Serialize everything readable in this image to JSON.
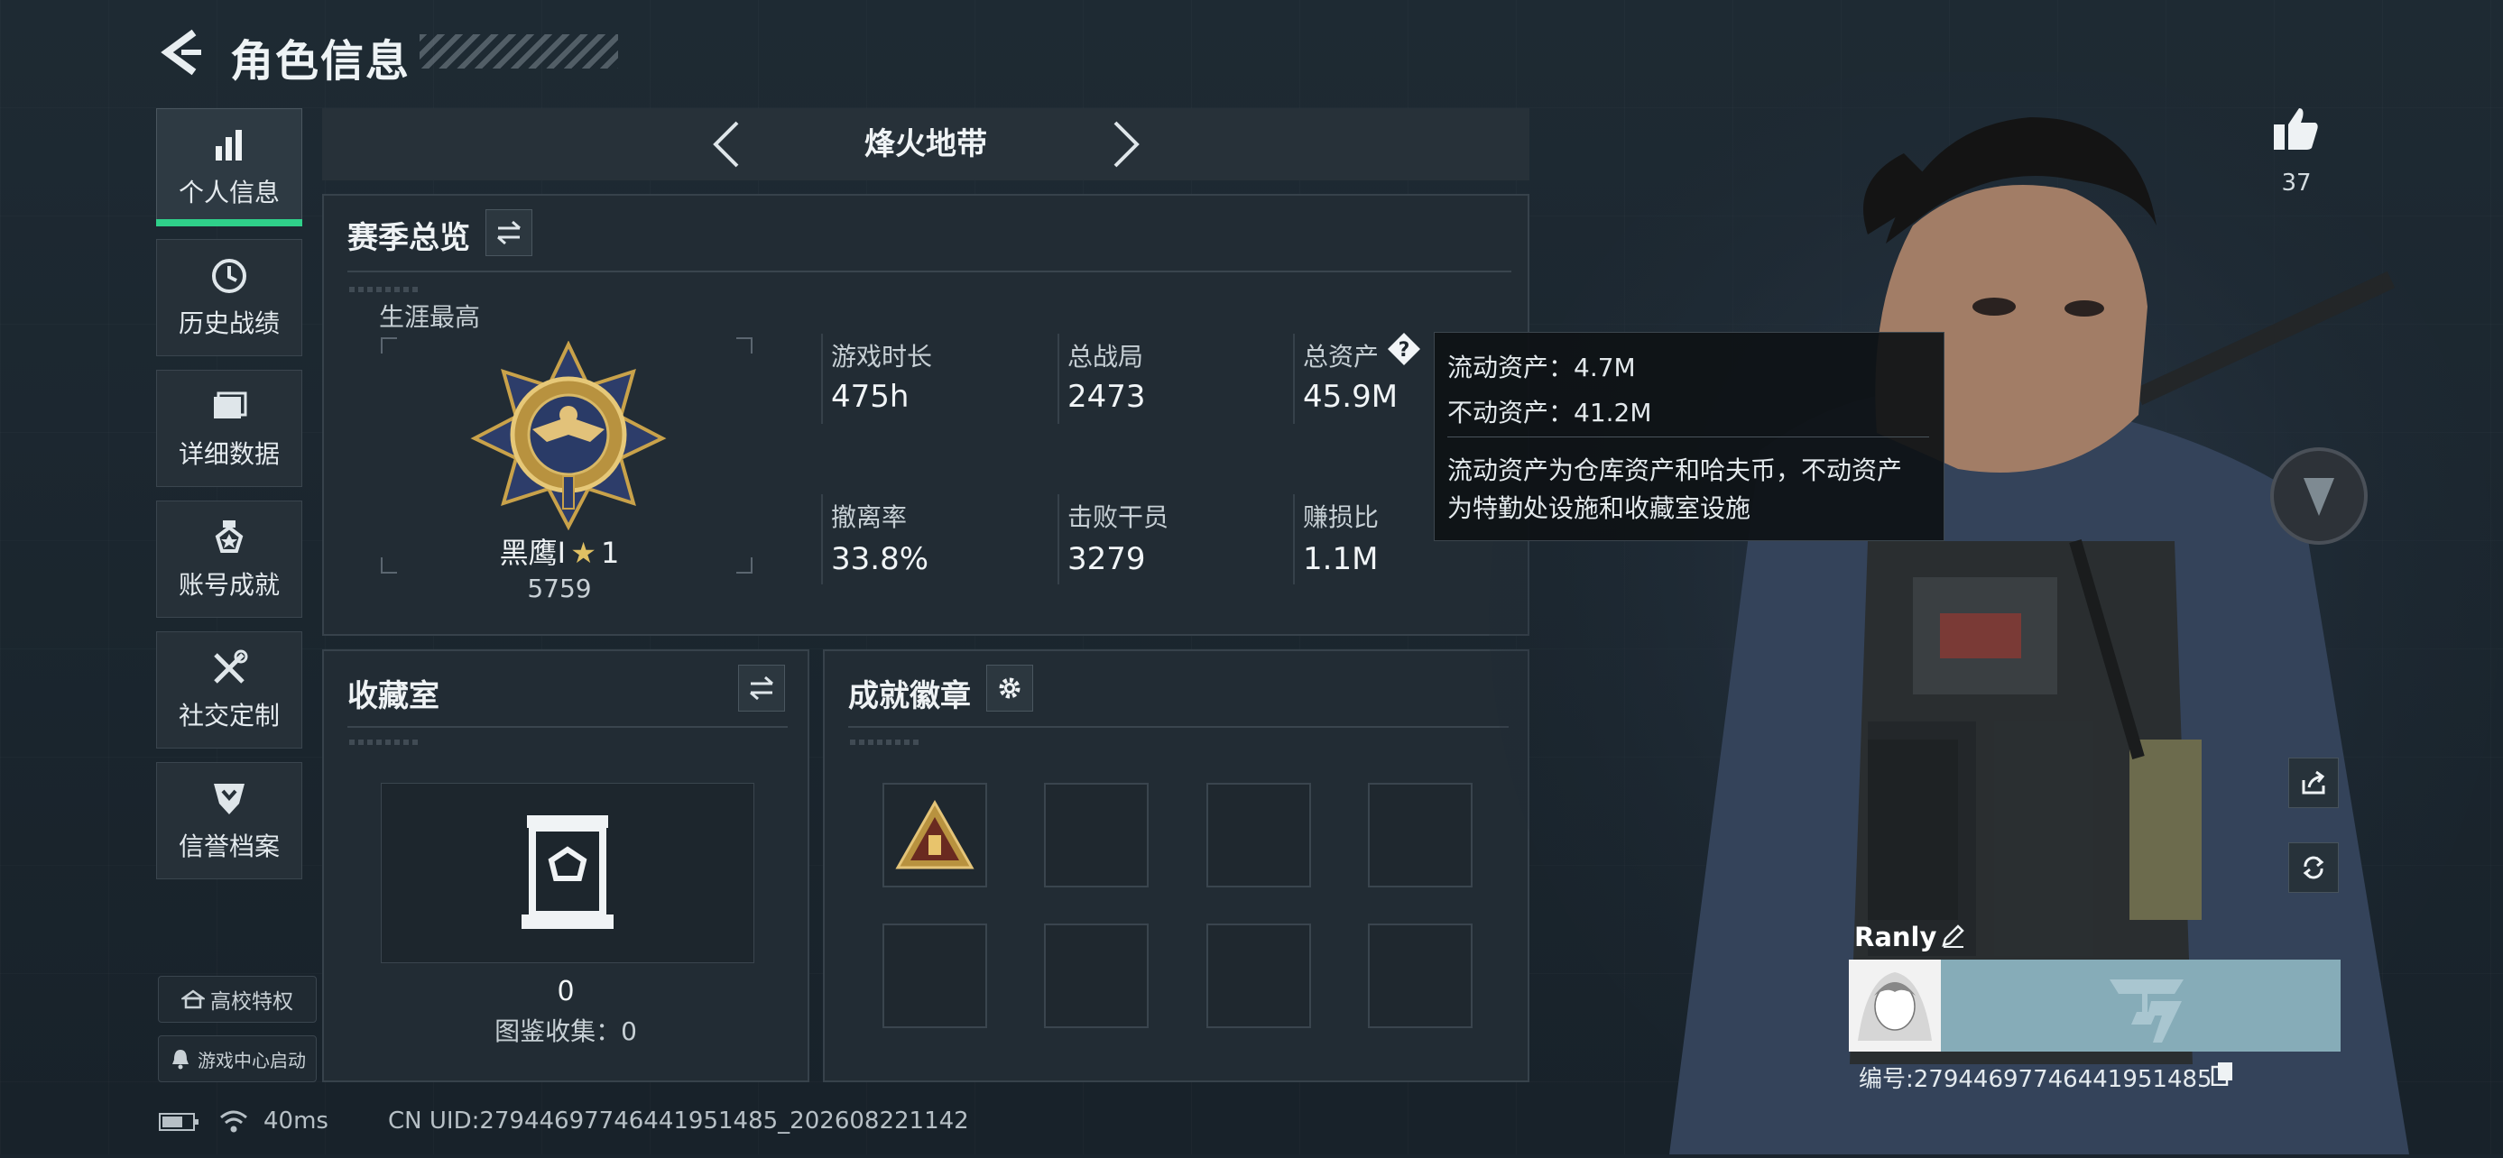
{
  "header": {
    "title": "角色信息"
  },
  "sidebar": {
    "items": [
      {
        "label": "个人信息",
        "icon": "bar-chart-icon",
        "active": true
      },
      {
        "label": "历史战绩",
        "icon": "history-clock-icon"
      },
      {
        "label": "详细数据",
        "icon": "folder-icon"
      },
      {
        "label": "账号成就",
        "icon": "medal-icon"
      },
      {
        "label": "社交定制",
        "icon": "tools-icon"
      },
      {
        "label": "信誉档案",
        "icon": "shield-icon"
      }
    ],
    "campus_privilege": "高校特权",
    "game_center": "游戏中心启动"
  },
  "mode": {
    "name": "烽火地带"
  },
  "season": {
    "title": "赛季总览",
    "career_best_label": "生涯最高",
    "rank_name": "黑鹰I",
    "rank_stars": "1",
    "rank_score": "5759",
    "stats": [
      {
        "label": "游戏时长",
        "value": "475h"
      },
      {
        "label": "总战局",
        "value": "2473"
      },
      {
        "label": "总资产",
        "value": "45.9M"
      },
      {
        "label": "撤离率",
        "value": "33.8%"
      },
      {
        "label": "击败干员",
        "value": "3279"
      },
      {
        "label": "赚损比",
        "value": "1.1M"
      }
    ]
  },
  "tooltip": {
    "liquid": "流动资产：4.7M",
    "fixed": "不动资产：41.2M",
    "desc_line1": "流动资产为仓库资产和哈夫币，不动资产",
    "desc_line2": "为特勤处设施和收藏室设施"
  },
  "collection": {
    "title": "收藏室",
    "count": "0",
    "codex": "图鉴收集：0"
  },
  "achievements": {
    "title": "成就徽章"
  },
  "player": {
    "likes": "37",
    "name": "Ranly",
    "id_label": "编号:27944697746441951485"
  },
  "status_bar": {
    "ping": "40ms",
    "uid": "CN UID:27944697746441951485_202608221142"
  },
  "colors": {
    "accent_green": "#2fd08a",
    "panel_bg": "#222c34",
    "page_bg": "#1a242d",
    "gold": "#c9a24a",
    "card_teal": "#86acb8"
  }
}
